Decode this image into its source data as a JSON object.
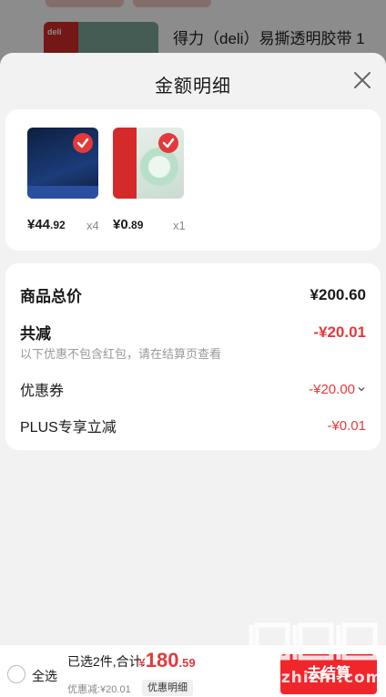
{
  "background": {
    "product_title": "得力（deli）易撕透明胶带 1",
    "thumb_brand": "deli"
  },
  "sheet": {
    "title": "金额明细",
    "products": [
      {
        "price_int": "¥44",
        "price_dec": ".92",
        "qty": "x4"
      },
      {
        "price_int": "¥0",
        "price_dec": ".89",
        "qty": "x1"
      }
    ],
    "summary": {
      "total_label": "商品总价",
      "total_value": "¥200.60",
      "reduce_label": "共减",
      "reduce_value": "-¥20.01",
      "hint": "以下优惠不包含红包，请在结算页查看",
      "coupon_label": "优惠券",
      "coupon_value": "-¥20.00",
      "plus_label": "PLUS专享立减",
      "plus_value": "-¥0.01"
    }
  },
  "bottom_bar": {
    "select_all": "全选",
    "selected_text": "已选2件,合计:",
    "total_currency": "¥",
    "total_int": "180",
    "total_dec": ".59",
    "discount_text": "优惠减:¥20.01",
    "detail_button": "优惠明细",
    "checkout_button": "去结算"
  },
  "watermark": {
    "text": "zhizhizhi.com"
  },
  "colors": {
    "accent_red": "#e4393c",
    "checkout_red": "#f0262b"
  }
}
